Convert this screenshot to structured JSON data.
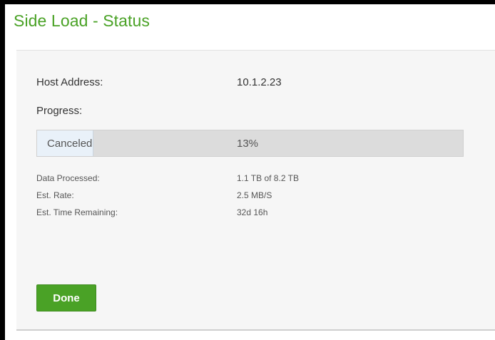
{
  "dialog": {
    "title": "Side Load - Status"
  },
  "fields": {
    "host_address_label": "Host Address:",
    "host_address_value": "10.1.2.23",
    "progress_label": "Progress:"
  },
  "progress": {
    "status": "Canceled",
    "percent_text": "13%",
    "fraction": 0.13
  },
  "stats": {
    "data_processed_label": "Data Processed:",
    "data_processed_value": "1.1 TB of 8.2 TB",
    "est_rate_label": "Est. Rate:",
    "est_rate_value": "2.5 MB/S",
    "est_time_label": "Est. Time Remaining:",
    "est_time_value": "32d 16h"
  },
  "actions": {
    "done_label": "Done"
  },
  "colors": {
    "accent": "#4aa226",
    "panel_bg": "#f6f6f6",
    "progress_track": "#dcdcdc",
    "progress_fill": "#e9f1f9"
  }
}
